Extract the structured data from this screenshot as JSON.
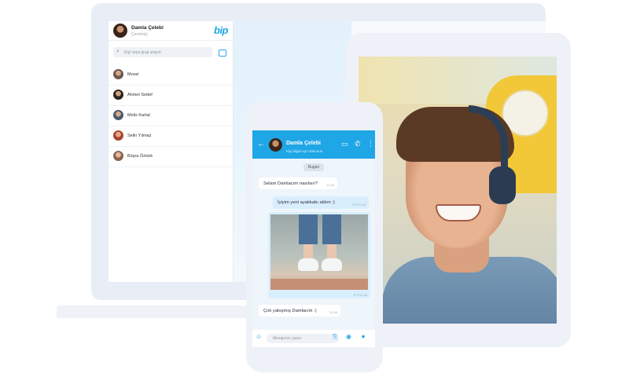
{
  "desktop": {
    "header": {
      "name": "Damla Çelebi",
      "status": "Çevrimiçi",
      "logo": "bip"
    },
    "search": {
      "placeholder": "Kişi veya grup arayın"
    },
    "contacts": [
      {
        "name": "Murat"
      },
      {
        "name": "Ahmet Sedef"
      },
      {
        "name": "Melis Kartal"
      },
      {
        "name": "Selin Yılmaz"
      },
      {
        "name": "Büşra Öztürk"
      }
    ]
  },
  "phone": {
    "header": {
      "name": "Damla Çelebi",
      "subtitle": "Kişi bilgisi için dokunun"
    },
    "day_label": "Bugün",
    "messages": [
      {
        "direction": "in",
        "text": "Selam Damlacım nasılsın?",
        "time": "12:43"
      },
      {
        "direction": "out",
        "text": "İyiyim yeni ayakkabı aldım :)",
        "time": "12:45",
        "ticks": "✓✓"
      },
      {
        "direction": "out",
        "type": "image",
        "time": "12:46",
        "ticks": "✓✓"
      },
      {
        "direction": "in",
        "text": "Çok yakışmış Damlacım :)",
        "time": "12:46"
      }
    ],
    "input": {
      "placeholder": "Mesajınızı yazın"
    }
  },
  "colors": {
    "brand": "#1fa6e6",
    "outgoing_bubble": "#d9eefc",
    "incoming_bubble": "#ffffff"
  },
  "icons": [
    "search-icon",
    "compose-icon",
    "back-arrow-icon",
    "video-call-icon",
    "phone-call-icon",
    "more-options-icon",
    "emoji-icon",
    "attachment-icon",
    "camera-icon",
    "microphone-icon"
  ]
}
